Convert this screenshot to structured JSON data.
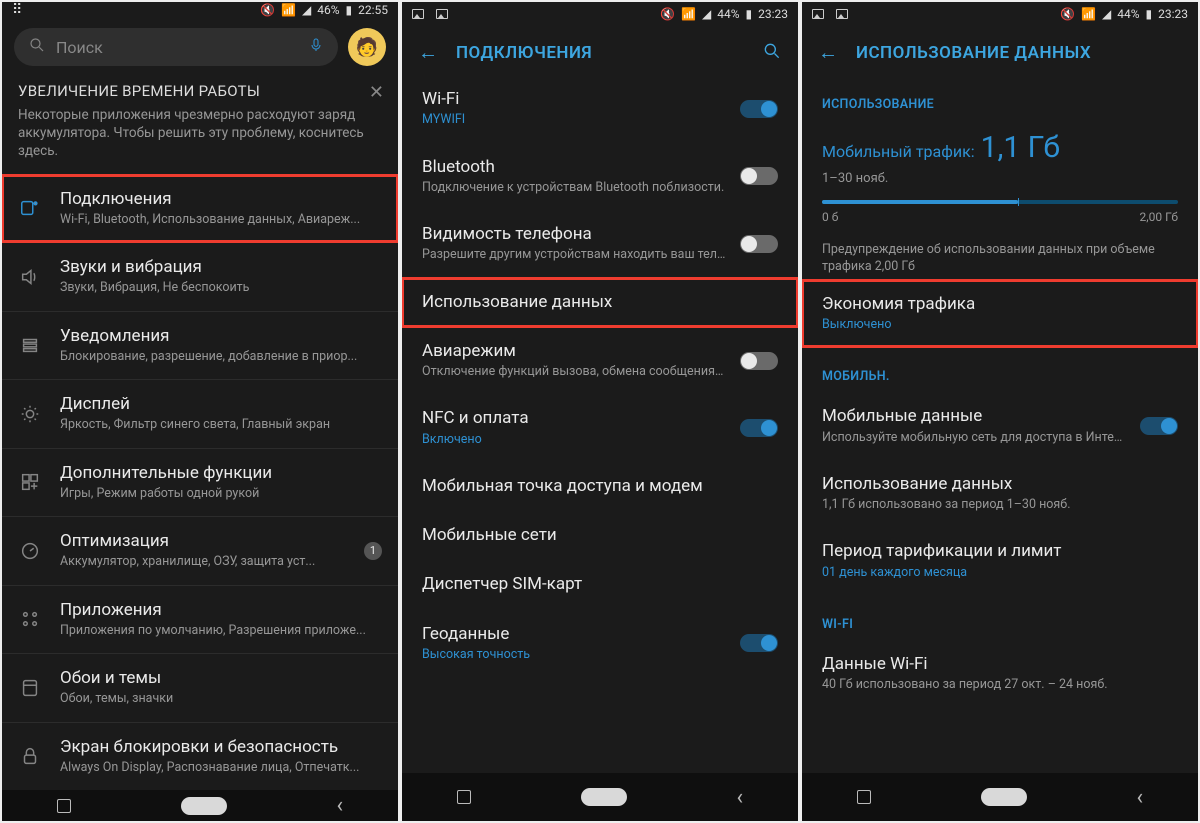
{
  "screen1": {
    "status": {
      "battery": "46%",
      "time": "22:55"
    },
    "search_placeholder": "Поиск",
    "notice": {
      "title": "УВЕЛИЧЕНИЕ ВРЕМЕНИ РАБОТЫ",
      "body": "Некоторые приложения чрезмерно расходуют заряд аккумулятора. Чтобы решить эту проблему, коснитесь здесь."
    },
    "items": [
      {
        "title": "Подключения",
        "sub": "Wi-Fi, Bluetooth, Использование данных, Авиареж...",
        "highlight": true,
        "icon": "connections"
      },
      {
        "title": "Звуки и вибрация",
        "sub": "Звуки, Вибрация, Не беспокоить",
        "icon": "sound"
      },
      {
        "title": "Уведомления",
        "sub": "Блокирование, разрешение, добавление в приор...",
        "icon": "notifications"
      },
      {
        "title": "Дисплей",
        "sub": "Яркость, Фильтр синего света, Главный экран",
        "icon": "display"
      },
      {
        "title": "Дополнительные функции",
        "sub": "Игры, Режим работы одной рукой",
        "icon": "advanced"
      },
      {
        "title": "Оптимизация",
        "sub": "Аккумулятор, хранилище, ОЗУ, защита уст...",
        "icon": "optimization",
        "badge": "1"
      },
      {
        "title": "Приложения",
        "sub": "Приложения по умолчанию, Разрешения приложе...",
        "icon": "apps"
      },
      {
        "title": "Обои и темы",
        "sub": "Обои, темы, значки",
        "icon": "wallpaper"
      },
      {
        "title": "Экран блокировки и безопасность",
        "sub": "Always On Display, Распознавание лица, Отпечатк...",
        "icon": "lock"
      }
    ]
  },
  "screen2": {
    "status": {
      "battery": "44%",
      "time": "23:23"
    },
    "header": "ПОДКЛЮЧЕНИЯ",
    "rows": [
      {
        "title": "Wi-Fi",
        "sub": "MYWIFI",
        "sub_blue": true,
        "toggle": "on"
      },
      {
        "title": "Bluetooth",
        "sub": "Подключение к устройствам Bluetooth поблизости.",
        "toggle": "off"
      },
      {
        "title": "Видимость телефона",
        "sub": "Разрешите другим устройствам находить ваш телефон и передавать файлы.",
        "toggle": "off"
      },
      {
        "title": "Использование данных",
        "highlight": true
      },
      {
        "title": "Авиарежим",
        "sub": "Отключение функций вызова, обмена сообщениями и мобильных данных.",
        "toggle": "off"
      },
      {
        "title": "NFC и оплата",
        "sub": "Включено",
        "sub_blue": true,
        "toggle": "on"
      },
      {
        "title": "Мобильная точка доступа и модем"
      },
      {
        "title": "Мобильные сети"
      },
      {
        "title": "Диспетчер SIM-карт"
      },
      {
        "title": "Геоданные",
        "sub": "Высокая точность",
        "sub_blue": true,
        "toggle": "on"
      }
    ]
  },
  "screen3": {
    "status": {
      "battery": "44%",
      "time": "23:23"
    },
    "header": "ИСПОЛЬЗОВАНИЕ ДАННЫХ",
    "section_usage": "ИСПОЛЬЗОВАНИЕ",
    "usage_label": "Мобильный трафик:",
    "usage_value": "1,1 Гб",
    "usage_range": "1–30 нояб.",
    "bar_min": "0 б",
    "bar_max": "2,00 Гб",
    "warning": "Предупреждение об использовании данных при объеме трафика 2,00 Гб",
    "saver": {
      "title": "Экономия трафика",
      "sub": "Выключено"
    },
    "section_mobile": "МОБИЛЬН.",
    "mobile_data": {
      "title": "Мобильные данные",
      "sub": "Используйте мобильную сеть для доступа в Интернет."
    },
    "mobile_usage": {
      "title": "Использование данных",
      "sub": "1,1 Гб использовано за период 1–30 нояб."
    },
    "billing": {
      "title": "Период тарификации и лимит",
      "sub": "01 день каждого месяца"
    },
    "section_wifi": "WI-FI",
    "wifi_data": {
      "title": "Данные Wi-Fi",
      "sub": "40 Гб использовано за период 27 окт. – 24 нояб."
    }
  }
}
